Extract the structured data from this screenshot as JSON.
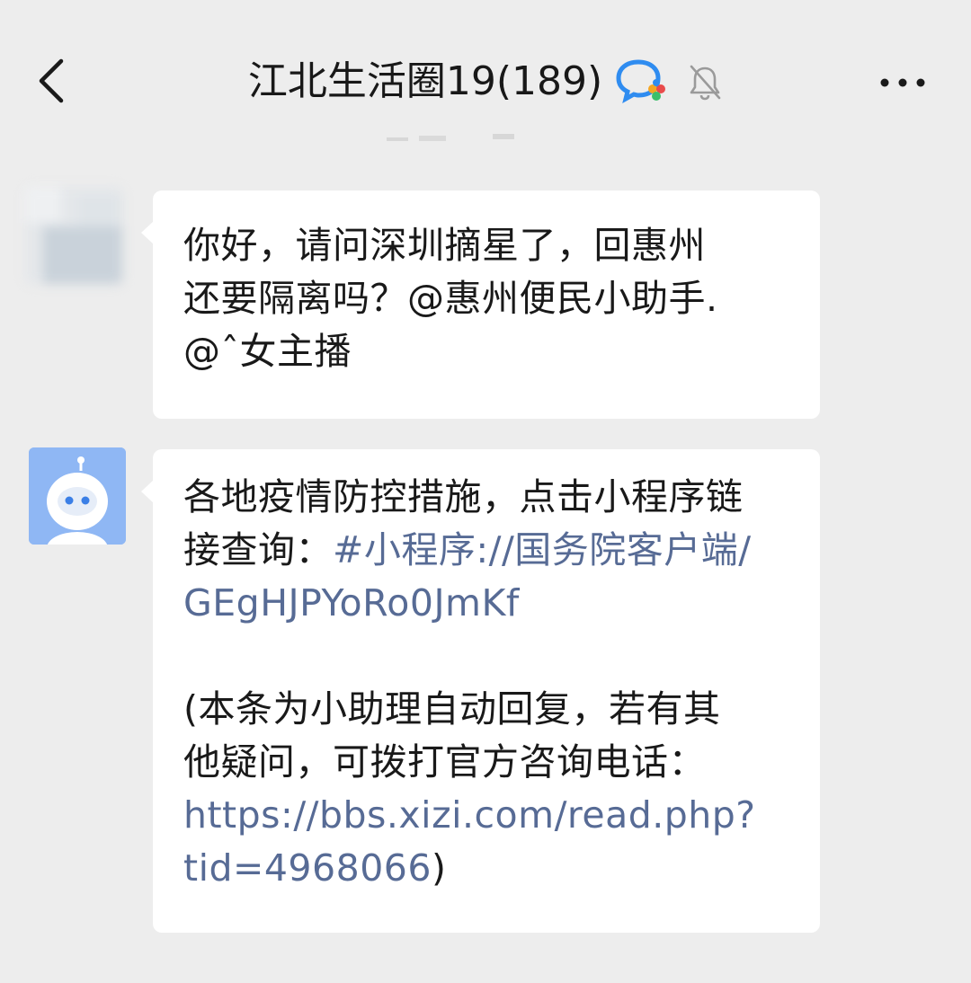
{
  "header": {
    "title": "江北生活圈19(189)",
    "back_icon": "chevron-left-icon",
    "group_badge_icon": "chat-bubbles-icon",
    "mute_icon": "bell-off-icon",
    "more_icon": "more-dots-icon"
  },
  "messages": [
    {
      "sender": "user",
      "avatar": "blurred-avatar",
      "lines": [
        "你好，请问深圳摘星了，回惠州",
        "还要隔离吗？@惠州便民小助手.",
        "@ˆ女主播"
      ]
    },
    {
      "sender": "bot",
      "avatar": "robot-avatar",
      "line1": "各地疫情防控措施，点击小程序链",
      "line2_text": "接查询：",
      "line2_link": "#小程序://国务院客户端/",
      "line3_link": "GEgHJPYoRo0JmKf",
      "line4": "(本条为小助理自动回复，若有其",
      "line5": "他疑问，可拨打官方咨询电话：",
      "line6_link": "https://bbs.xizi.com/read.php?",
      "line7_link": "tid=4968066",
      "line7_text": ")"
    }
  ],
  "colors": {
    "background": "#ededed",
    "bubble": "#ffffff",
    "link": "#576b95",
    "bot_avatar": "#8fb7f4"
  }
}
